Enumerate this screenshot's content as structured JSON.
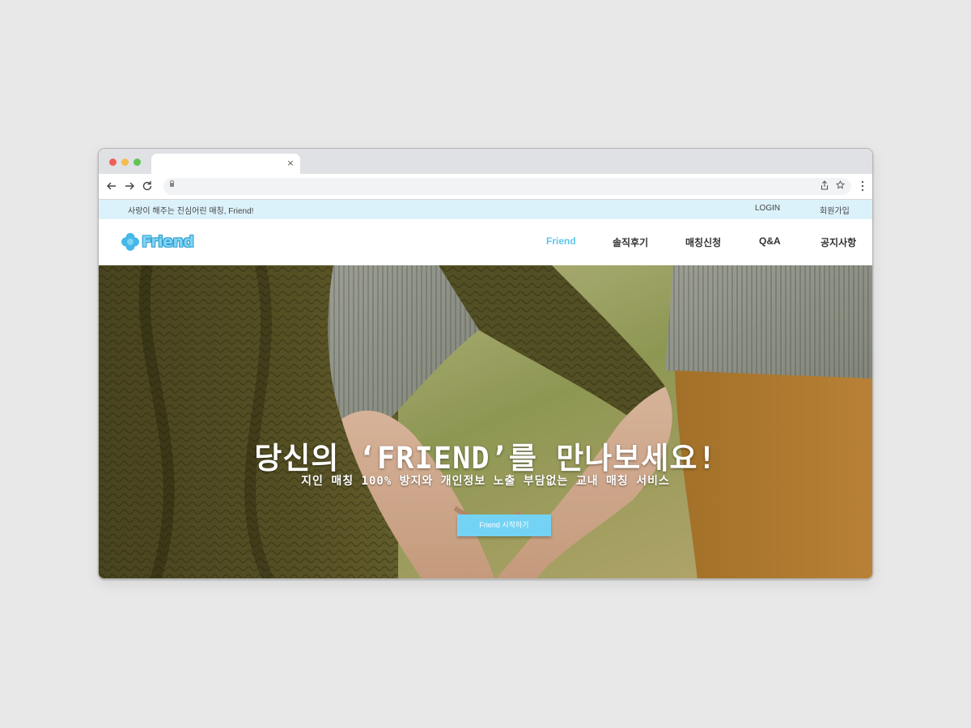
{
  "browser": {
    "tab_close": "×",
    "icons": {
      "back": "back-arrow-icon",
      "forward": "forward-arrow-icon",
      "reload": "reload-icon",
      "share": "share-icon",
      "bookmark": "star-icon",
      "menu": "more-menu-icon"
    }
  },
  "site": {
    "tagline": "사랑이 해주는 진심어린 매칭, Friend!",
    "top_links": {
      "login": "LOGIN",
      "signup": "회원가입"
    },
    "logo_text": "Friend",
    "nav": [
      "Friend",
      "솔직후기",
      "매칭신청",
      "Q&A",
      "공지사항"
    ],
    "active_nav": "Friend",
    "accent_color": "#5fc6ea",
    "strip_color": "#dcf2fb"
  },
  "hero": {
    "title": "당신의 ‘FRIEND’를 만나보세요!",
    "subtitle": "지인 매칭 100% 방지와 개인정보 노출 부담없는 교내 매칭 서비스",
    "cta": "Friend 시작하기",
    "cta_color": "#74d3f4"
  }
}
